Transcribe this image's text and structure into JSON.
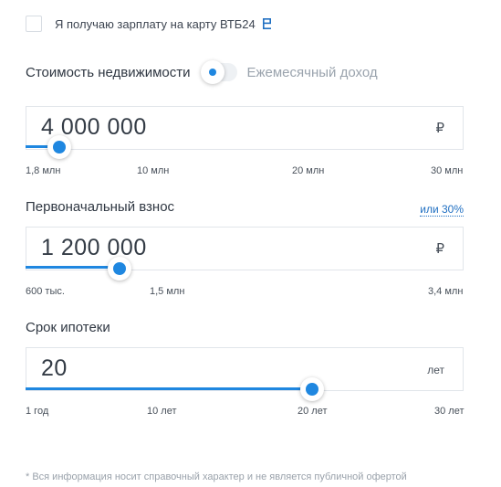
{
  "salary": {
    "label": "Я получаю зарплату на карту ВТБ24",
    "checked": false
  },
  "mode_toggle": {
    "left_label": "Стоимость недвижимости",
    "right_label": "Ежемесячный доход",
    "active": "left"
  },
  "property_cost": {
    "value": "4 000 000",
    "unit": "₽",
    "slider_fraction": 0.077,
    "ticks": [
      "1,8 млн",
      "10 млн",
      "20 млн",
      "30 млн"
    ]
  },
  "down_payment": {
    "label": "Первоначальный взнос",
    "percent_link": "или 30%",
    "value": "1 200 000",
    "unit": "₽",
    "slider_fraction": 0.215,
    "ticks": [
      "600 тыс.",
      "1,5 млн",
      "3,4 млн"
    ]
  },
  "term": {
    "label": "Срок ипотеки",
    "value": "20",
    "unit": "лет",
    "slider_fraction": 0.655,
    "ticks": [
      "1 год",
      "10 лет",
      "20 лет",
      "30 лет"
    ]
  },
  "footnote": "* Вся информация носит справочный характер и не является публичной офертой",
  "colors": {
    "accent": "#1f87e0",
    "link": "#1f6fc2",
    "muted": "#9aa3ad"
  }
}
